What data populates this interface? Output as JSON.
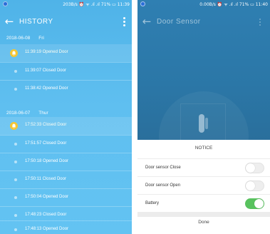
{
  "left": {
    "status": {
      "text": "203B/s ⏰ ᯤ .ıl .ıl 71% ▭ 11:39"
    },
    "title": "HISTORY",
    "groups": [
      {
        "date": "2018-06-08",
        "day": "Fri",
        "entries": [
          {
            "time": "11:39:19",
            "event": "Opened Door"
          },
          {
            "time": "11:39:07",
            "event": "Closed Door"
          },
          {
            "time": "11:38:42",
            "event": "Opened Door"
          }
        ]
      },
      {
        "date": "2018-06-07",
        "day": "Thur",
        "entries": [
          {
            "time": "17:52:33",
            "event": "Closed Door"
          },
          {
            "time": "17:51:57",
            "event": "Closed Door"
          },
          {
            "time": "17:50:18",
            "event": "Opened Door"
          },
          {
            "time": "17:50:11",
            "event": "Closed Door"
          },
          {
            "time": "17:50:04",
            "event": "Opened Door"
          },
          {
            "time": "17:48:23",
            "event": "Closed Door"
          },
          {
            "time": "17:48:13",
            "event": "Opened Door"
          }
        ]
      }
    ],
    "colors": {
      "background": "#5fbff0",
      "bell": "#f6c633"
    }
  },
  "right": {
    "status": {
      "text": "0.00B/s ⏰ ᯤ .ıl .ıl 71% ▭ 11:40"
    },
    "title": "Door Sensor",
    "sheet": {
      "heading": "NOTICE",
      "options": [
        {
          "label": "Door sensor Close",
          "enabled": false
        },
        {
          "label": "Door sensor Open",
          "enabled": false
        },
        {
          "label": "Battery",
          "enabled": true
        }
      ],
      "done_label": "Done"
    },
    "colors": {
      "hero": "#2b77a7",
      "toggle_on": "#58c25e"
    }
  }
}
